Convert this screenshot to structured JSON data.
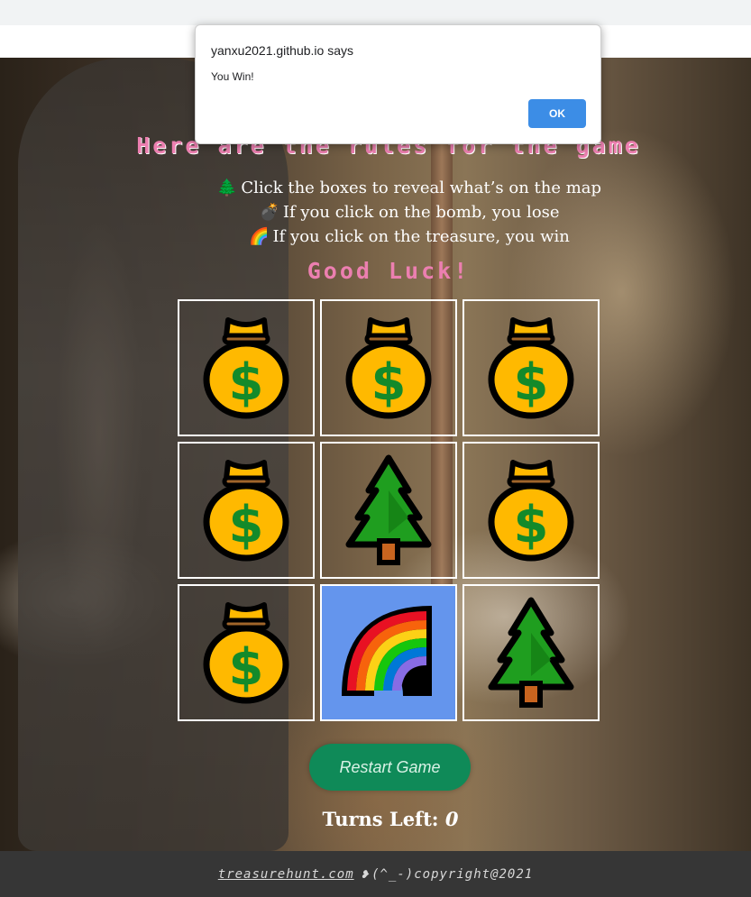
{
  "dialog": {
    "title": "yanxu2021.github.io says",
    "message": "You Win!",
    "ok_label": "OK"
  },
  "rules": {
    "heading": "Here are the rules for the game",
    "lines": [
      {
        "icon": "tree-icon",
        "text": "Click the boxes to reveal what’s on the map"
      },
      {
        "icon": "bomb-icon",
        "text": "If you click on the bomb, you lose"
      },
      {
        "icon": "rainbow-icon",
        "text": "If you click on the treasure, you win"
      }
    ],
    "good_luck": "Good Luck!"
  },
  "board": {
    "cells": [
      "money-bag-icon",
      "money-bag-icon",
      "money-bag-icon",
      "money-bag-icon",
      "tree-icon",
      "money-bag-icon",
      "money-bag-icon",
      "rainbow-icon",
      "tree-icon"
    ],
    "highlight_color": "#6495ed"
  },
  "restart_label": "Restart Game",
  "turns": {
    "label": "Turns Left:",
    "value": "0"
  },
  "footer": {
    "link": "treasurehunt.com",
    "text": "(^_-)copyright@2021"
  },
  "colors": {
    "heading_pink": "#ec7fb0",
    "button_green": "#0f8a58",
    "ok_blue": "#3c8de6"
  }
}
